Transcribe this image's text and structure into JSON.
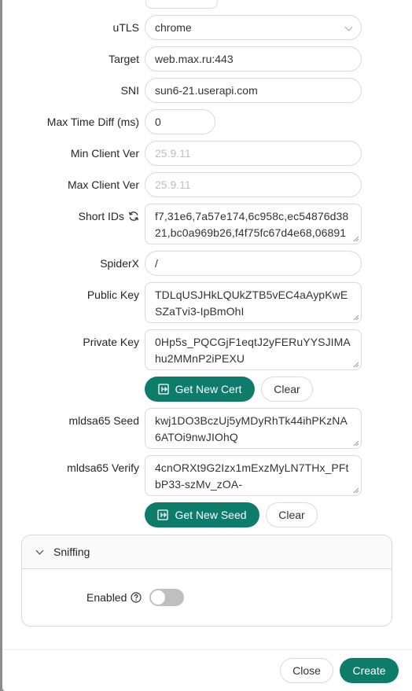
{
  "form": {
    "utls": {
      "label": "uTLS",
      "value": "chrome"
    },
    "target": {
      "label": "Target",
      "value": "web.max.ru:443"
    },
    "sni": {
      "label": "SNI",
      "value": "sun6-21.userapi.com"
    },
    "max_time_diff": {
      "label": "Max Time Diff (ms)",
      "value": "0"
    },
    "min_client_ver": {
      "label": "Min Client Ver",
      "placeholder": "25.9.11"
    },
    "max_client_ver": {
      "label": "Max Client Ver",
      "placeholder": "25.9.11"
    },
    "short_ids": {
      "label": "Short IDs",
      "value": "f7,31e6,7a57e174,6c958c,ec54876d3821,bc0a969b26,f4f75fc67d4e68,06891"
    },
    "spiderx": {
      "label": "SpiderX",
      "value": "/"
    },
    "public_key": {
      "label": "Public Key",
      "value": "TDLqUSJHkLQUkZTB5vEC4aAypKwESZaTvi3-IpBmOhI"
    },
    "private_key": {
      "label": "Private Key",
      "value": "0Hp5s_PQCGjF1eqtJ2yFERuYYSJIMAhu2MMnP2iPEXU"
    },
    "get_new_cert": "Get New Cert",
    "clear_cert": "Clear",
    "mldsa65_seed": {
      "label": "mldsa65 Seed",
      "value": "kwj1DO3BczUj5yMDyRhTk44ihPKzNA6ATOi9nwJIOhQ"
    },
    "mldsa65_verify": {
      "label": "mldsa65 Verify",
      "value": "4cnORXt9G2Izx1mExzMyLN7THx_PFtbP33-szMv_zOA-"
    },
    "get_new_seed": "Get New Seed",
    "clear_seed": "Clear"
  },
  "sniffing": {
    "title": "Sniffing",
    "enabled_label": "Enabled",
    "enabled": false
  },
  "footer": {
    "close": "Close",
    "create": "Create"
  },
  "colors": {
    "primary": "#0e7c6b",
    "border": "#d9d9d9"
  }
}
